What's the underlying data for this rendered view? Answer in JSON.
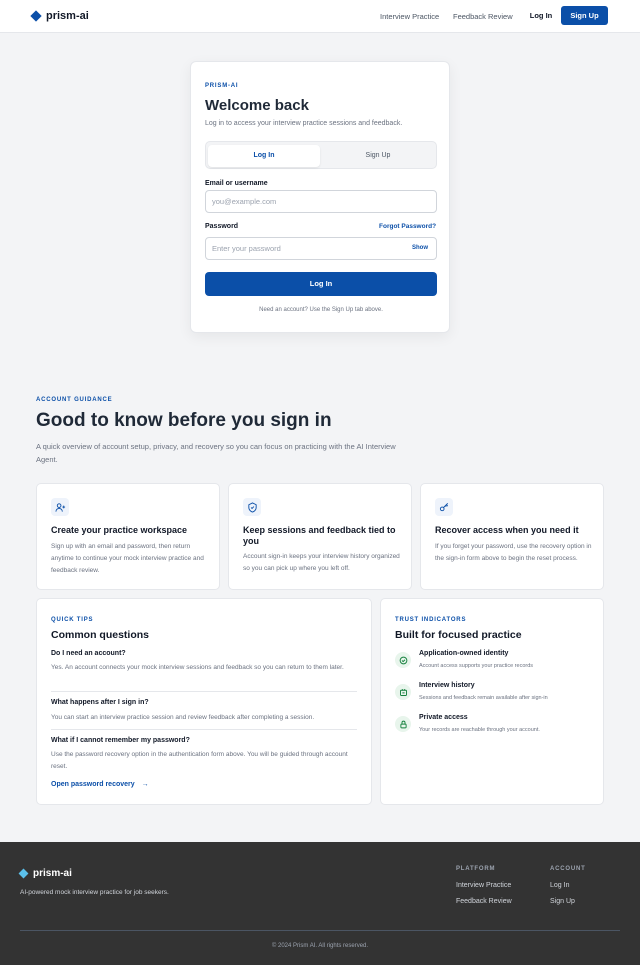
{
  "header": {
    "brand": "prism-ai",
    "nav": [
      "Interview Practice",
      "Feedback Review"
    ],
    "login_label": "Log In",
    "signup_label": "Sign Up"
  },
  "login": {
    "eyebrow": "PRISM-AI",
    "title": "Welcome back",
    "subtitle": "Log in to access your interview practice sessions and feedback.",
    "tabs": [
      {
        "label": "Log In",
        "active": true
      },
      {
        "label": "Sign Up",
        "active": false
      }
    ],
    "email_label": "Email or username",
    "email_placeholder": "you@example.com",
    "password_label": "Password",
    "forgot_label": "Forgot Password?",
    "password_placeholder": "Enter your password",
    "show_label": "Show",
    "submit_label": "Log In",
    "note": "Need an account? Use the Sign Up tab above."
  },
  "guidance": {
    "eyebrow": "ACCOUNT GUIDANCE",
    "title": "Good to know before you sign in",
    "description": "A quick overview of account setup, privacy, and recovery so you can focus on practicing with the AI Interview Agent.",
    "cards": [
      {
        "icon": "user-plus-icon",
        "title": "Create your practice workspace",
        "text": "Sign up with an email and password, then return anytime to continue your mock interview practice and feedback review."
      },
      {
        "icon": "shield-check-icon",
        "title": "Keep sessions and feedback tied to you",
        "text": "Account sign-in keeps your interview history organized so you can pick up where you left off."
      },
      {
        "icon": "key-icon",
        "title": "Recover access when you need it",
        "text": "If you forget your password, use the recovery option in the sign-in form above to begin the reset process."
      }
    ]
  },
  "faq": {
    "eyebrow": "QUICK TIPS",
    "title": "Common questions",
    "items": [
      {
        "q": "Do I need an account?",
        "a": "Yes. An account connects your mock interview sessions and feedback so you can return to them later."
      },
      {
        "q": "What happens after I sign in?",
        "a": "You can start an interview practice session and review feedback after completing a session."
      },
      {
        "q": "What if I cannot remember my password?",
        "a": "Use the password recovery option in the authentication form above. You will be guided through account reset."
      }
    ],
    "link": "Open password recovery",
    "link_arrow": "→"
  },
  "trust": {
    "eyebrow": "TRUST INDICATORS",
    "title": "Built for focused practice",
    "items": [
      {
        "icon": "check-circle-icon",
        "label": "Application-owned identity",
        "desc": "Account access supports your practice records"
      },
      {
        "icon": "history-icon",
        "label": "Interview history",
        "desc": "Sessions and feedback remain available after sign-in"
      },
      {
        "icon": "lock-icon",
        "label": "Private access",
        "desc": "Your records are reachable through your account."
      }
    ]
  },
  "footer": {
    "brand": "prism-ai",
    "tagline": "AI-powered mock interview practice for job seekers.",
    "platform_heading": "PLATFORM",
    "platform_links": [
      "Interview Practice",
      "Feedback Review"
    ],
    "account_heading": "ACCOUNT",
    "account_links": [
      "Log In",
      "Sign Up"
    ],
    "copyright": "© 2024 Prism AI. All rights reserved."
  },
  "colors": {
    "accent": "#0b4fa8",
    "footer_bg": "#333333",
    "trust_icon_bg": "#e8f5ec"
  }
}
